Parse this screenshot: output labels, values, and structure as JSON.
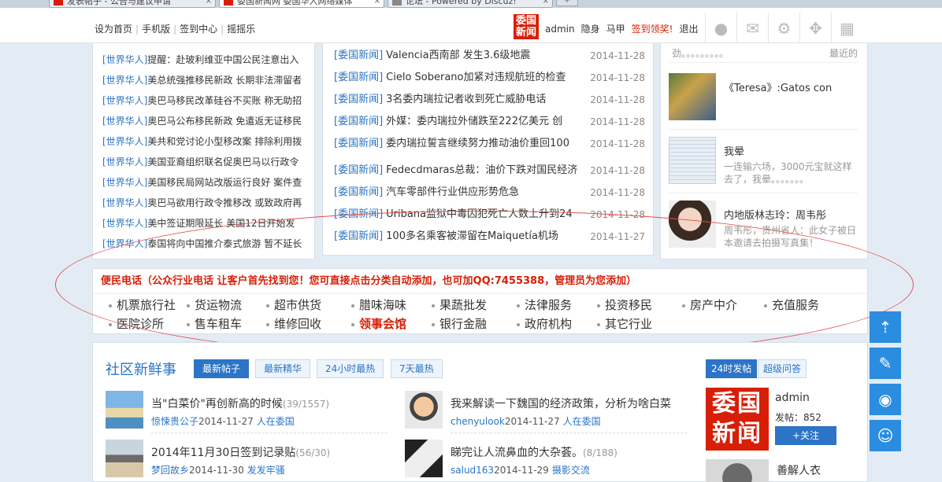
{
  "colors": {
    "brand": "#d81e06",
    "link": "#2b74c6",
    "accent_blue": "#2b8de0",
    "page_bg": "#e3ecf4"
  },
  "browser_tabs": [
    {
      "label": "发表帖子 - 公告与建议申请"
    },
    {
      "label": "委国新闻网 委国华人网络媒体"
    },
    {
      "label": "论坛 - Powered by Discuz!"
    }
  ],
  "topbar": {
    "links": [
      "设为首页",
      "手机版",
      "签到中心",
      "摇摇乐"
    ],
    "logo_text": "委国新闻",
    "username": "admin",
    "invisible": "隐身",
    "vest": "马甲",
    "signin": "签到领奖!",
    "logout": "退出",
    "icons": [
      "avatar-icon",
      "mail-icon",
      "gear-icon",
      "move-icon",
      "grid-icon"
    ]
  },
  "left_list": [
    {
      "tag": "[世界华人]",
      "text": "提醒：赴玻利维亚中国公民注意出入"
    },
    {
      "tag": "[世界华人]",
      "text": "美总统强推移民新政 长期非法滞留者"
    },
    {
      "tag": "[世界华人]",
      "text": "奥巴马移民改革硅谷不买账 称无助招"
    },
    {
      "tag": "[世界华人]",
      "text": "奥巴马公布移民新政 免遣返无证移民"
    },
    {
      "tag": "[世界华人]",
      "text": "美共和党讨论小型移改案 排除利用拨"
    },
    {
      "tag": "[世界华人]",
      "text": "美国亚裔组织联名促奥巴马以行政令"
    },
    {
      "tag": "[世界华人]",
      "text": "美国移民局网站改版运行良好 案件查"
    },
    {
      "tag": "[世界华人]",
      "text": "奥巴马欲用行政令推移改 或致政府再"
    },
    {
      "tag": "[世界华人]",
      "text": "美中签证期限延长 美国12日开始发"
    },
    {
      "tag": "[世界华人]",
      "text": "泰国将向中国推介泰式旅游 暂不延长"
    }
  ],
  "mid_list": [
    {
      "tag": "[委国新闻]",
      "text": "Valencia西南部 发生3.6级地震",
      "date": "2014-11-28"
    },
    {
      "tag": "[委国新闻]",
      "text": "Cielo Soberano加紧对违规航班的检查",
      "date": "2014-11-28"
    },
    {
      "tag": "[委国新闻]",
      "text": "3名委内瑞拉记者收到死亡威胁电话",
      "date": "2014-11-28"
    },
    {
      "tag": "[委国新闻]",
      "text": "外媒：委内瑞拉外储跌至222亿美元 创",
      "date": "2014-11-28"
    },
    {
      "tag": "[委国新闻]",
      "text": "委内瑞拉誓言继续努力推动油价重回100",
      "date": "2014-11-28"
    },
    {
      "tag": "[委国新闻]",
      "text": "Fedecdmaras总裁：油价下跌对国民经济",
      "date": "2014-11-28"
    },
    {
      "tag": "[委国新闻]",
      "text": "汽车零部件行业供应形势危急",
      "date": "2014-11-28"
    },
    {
      "tag": "[委国新闻]",
      "text": "Uribana监狱中毒囚犯死亡人数上升到24",
      "date": "2014-11-28"
    },
    {
      "tag": "[委国新闻]",
      "text": "100多名乘客被滞留在Maiquetía机场",
      "date": "2014-11-27"
    }
  ],
  "right_list": {
    "snippet": "劲。。。。。。。。。",
    "snippet_right": "最近的",
    "items": [
      {
        "title": "《Teresa》:Gatos con",
        "desc": ""
      },
      {
        "title": "我晕",
        "desc": "一连输六场，3000元宝就这样去了，我晕。。。。。。。"
      },
      {
        "title": "内地版林志玲：周韦彤",
        "desc": "周韦彤，贵州省人：此女子被日本邀请去拍摄写真集！"
      }
    ]
  },
  "service": {
    "header": "便民电话（公众行业电话 让客户首先找到您！您可直接点击分类自动添加，也可加QQ:7455388，管理员为您添加）",
    "row1": [
      "机票旅行社",
      "货运物流",
      "超市供货",
      "腊味海味",
      "果蔬批发",
      "法律服务",
      "投资移民",
      "房产中介",
      "充值服务"
    ],
    "row2": [
      "医院诊所",
      "售车租车",
      "维修回收",
      "领事会馆",
      "银行金融",
      "政府机构",
      "其它行业"
    ]
  },
  "community": {
    "title": "社区新鲜事",
    "tabs": [
      "最新帖子",
      "最新精华",
      "24小时最热",
      "7天最热"
    ],
    "posts": [
      {
        "title": "当\"白菜价\"再创新高的时候",
        "count": "(39/1557)",
        "user": "惊悚贵公子",
        "date": "2014-11-27",
        "loc": "人在委国"
      },
      {
        "title": "我来解读一下魏国的经济政策，分析为啥白菜",
        "count": "",
        "user": "chenyulook",
        "date": "2014-11-27",
        "loc": "人在委国"
      },
      {
        "title": "2014年11月30日签到记录贴",
        "count": "(56/30)",
        "user": "梦回故乡",
        "date": "2014-11-30",
        "loc": "发发牢骚"
      },
      {
        "title": "睇完让人流鼻血的大杂荟。",
        "count": "(8/188)",
        "user": "salud163",
        "date": "2014-11-29",
        "loc": "摄影交流"
      }
    ],
    "right_tabs": [
      "24时发帖",
      "超级问答"
    ],
    "user": {
      "logo": "委国新闻",
      "name": "admin",
      "stat": "发帖：852",
      "follow": "+关注",
      "post": "善解人衣"
    }
  },
  "side_buttons": [
    "arrow-up-icon",
    "edit-icon",
    "qq-icon",
    "user-icon"
  ]
}
